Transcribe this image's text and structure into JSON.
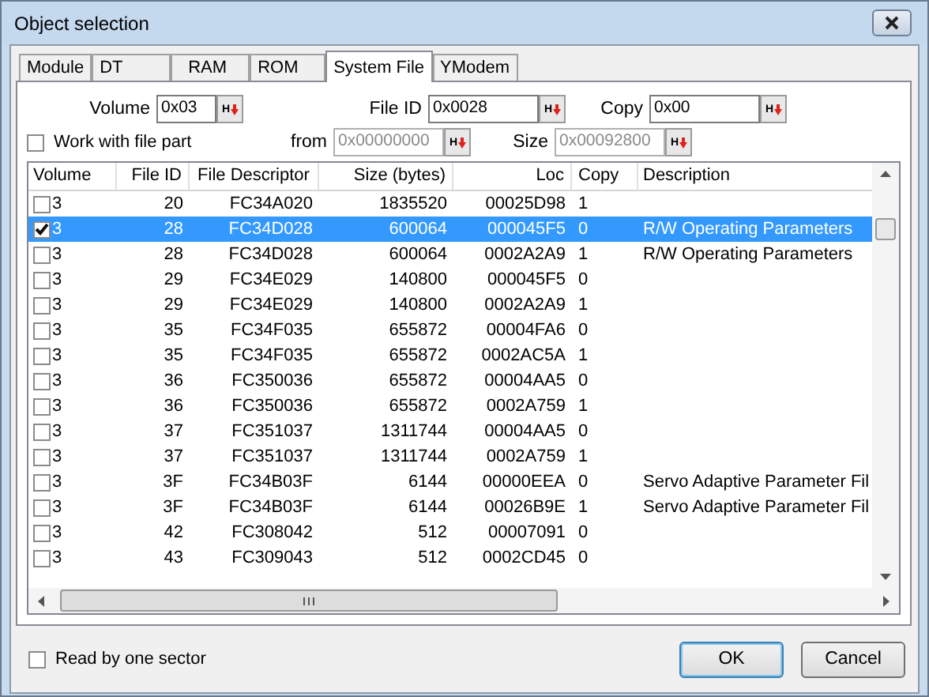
{
  "window": {
    "title": "Object selection"
  },
  "tabs": [
    {
      "label": "Module",
      "selected": false
    },
    {
      "label": "DT",
      "selected": false
    },
    {
      "label": "RAM",
      "selected": false
    },
    {
      "label": "ROM",
      "selected": false
    },
    {
      "label": "System File",
      "selected": true
    },
    {
      "label": "YModem",
      "selected": false
    }
  ],
  "fields": [
    {
      "label": "Volume",
      "value": "0x03",
      "button": "H",
      "disabled": false
    },
    {
      "label": "File ID",
      "value": "0x0028",
      "button": "H",
      "disabled": false
    },
    {
      "label": "Copy",
      "value": "0x00",
      "button": "H",
      "disabled": false
    },
    {
      "label": "from",
      "value": "0x00000000",
      "button": "H",
      "disabled": true
    },
    {
      "label": "Size",
      "value": "0x00092800",
      "button": "H",
      "disabled": true
    }
  ],
  "work_with_file_part": {
    "label": "Work with file part",
    "checked": false
  },
  "table": {
    "columns": [
      "Volume",
      "File ID",
      "File Descriptor",
      "Size (bytes)",
      "Loc",
      "Copy",
      "Description"
    ],
    "rows": [
      {
        "checked": false,
        "selected": false,
        "cells": [
          "3",
          "20",
          "FC34A020",
          "1835520",
          "00025D98",
          "1",
          ""
        ]
      },
      {
        "checked": true,
        "selected": true,
        "cells": [
          "3",
          "28",
          "FC34D028",
          "600064",
          "000045F5",
          "0",
          "R/W Operating Parameters"
        ]
      },
      {
        "checked": false,
        "selected": false,
        "cells": [
          "3",
          "28",
          "FC34D028",
          "600064",
          "0002A2A9",
          "1",
          "R/W Operating Parameters"
        ]
      },
      {
        "checked": false,
        "selected": false,
        "cells": [
          "3",
          "29",
          "FC34E029",
          "140800",
          "000045F5",
          "0",
          ""
        ]
      },
      {
        "checked": false,
        "selected": false,
        "cells": [
          "3",
          "29",
          "FC34E029",
          "140800",
          "0002A2A9",
          "1",
          ""
        ]
      },
      {
        "checked": false,
        "selected": false,
        "cells": [
          "3",
          "35",
          "FC34F035",
          "655872",
          "00004FA6",
          "0",
          ""
        ]
      },
      {
        "checked": false,
        "selected": false,
        "cells": [
          "3",
          "35",
          "FC34F035",
          "655872",
          "0002AC5A",
          "1",
          ""
        ]
      },
      {
        "checked": false,
        "selected": false,
        "cells": [
          "3",
          "36",
          "FC350036",
          "655872",
          "00004AA5",
          "0",
          ""
        ]
      },
      {
        "checked": false,
        "selected": false,
        "cells": [
          "3",
          "36",
          "FC350036",
          "655872",
          "0002A759",
          "1",
          ""
        ]
      },
      {
        "checked": false,
        "selected": false,
        "cells": [
          "3",
          "37",
          "FC351037",
          "1311744",
          "00004AA5",
          "0",
          ""
        ]
      },
      {
        "checked": false,
        "selected": false,
        "cells": [
          "3",
          "37",
          "FC351037",
          "1311744",
          "0002A759",
          "1",
          ""
        ]
      },
      {
        "checked": false,
        "selected": false,
        "cells": [
          "3",
          "3F",
          "FC34B03F",
          "6144",
          "00000EEA",
          "0",
          "Servo Adaptive Parameter Fil"
        ]
      },
      {
        "checked": false,
        "selected": false,
        "cells": [
          "3",
          "3F",
          "FC34B03F",
          "6144",
          "00026B9E",
          "1",
          "Servo Adaptive Parameter Fil"
        ]
      },
      {
        "checked": false,
        "selected": false,
        "cells": [
          "3",
          "42",
          "FC308042",
          "512",
          "00007091",
          "0",
          ""
        ]
      },
      {
        "checked": false,
        "selected": false,
        "cells": [
          "3",
          "43",
          "FC309043",
          "512",
          "0002CD45",
          "0",
          ""
        ]
      }
    ]
  },
  "read_by_one_sector": {
    "label": "Read by one sector",
    "checked": false
  },
  "buttons": [
    {
      "label": "OK",
      "kind": "default"
    },
    {
      "label": "Cancel",
      "kind": "normal"
    }
  ]
}
